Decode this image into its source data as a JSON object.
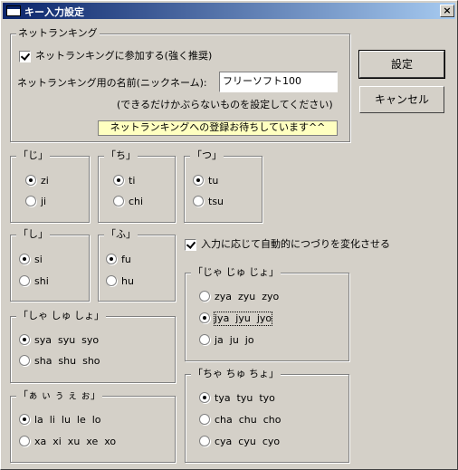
{
  "window": {
    "title": "キー入力設定",
    "close_label": "×"
  },
  "net_ranking": {
    "group_label": "ネットランキング",
    "participate_label": "ネットランキングに参加する(強く推奨)",
    "participate_checked": true,
    "name_label": "ネットランキング用の名前(ニックネーム):",
    "name_value": "フリーソフト100",
    "hint": "(できるだけかぶらないものを設定してください)",
    "status": "ネットランキングへの登録お待ちしています^^"
  },
  "buttons": {
    "ok": "設定",
    "cancel": "キャンセル"
  },
  "groups": {
    "ji": {
      "label": "「じ」",
      "options": [
        "zi",
        "ji"
      ],
      "selected": 0
    },
    "chi": {
      "label": "「ち」",
      "options": [
        "ti",
        "chi"
      ],
      "selected": 0
    },
    "tsu": {
      "label": "「つ」",
      "options": [
        "tu",
        "tsu"
      ],
      "selected": 0
    },
    "shi": {
      "label": "「し」",
      "options": [
        "si",
        "shi"
      ],
      "selected": 0
    },
    "fu": {
      "label": "「ふ」",
      "options": [
        "fu",
        "hu"
      ],
      "selected": 0
    },
    "sha": {
      "label": "「しゃ しゅ しょ」",
      "options": [
        "sya  syu  syo",
        "sha  shu  sho"
      ],
      "selected": 0
    },
    "small_vowel": {
      "label": "「ぁ ぃ ぅ ぇ ぉ」",
      "options": [
        "la  li  lu  le  lo",
        "xa  xi  xu  xe  xo"
      ],
      "selected": 0
    },
    "ja": {
      "label": "「じゃ じゅ じょ」",
      "options": [
        "zya  zyu  zyo",
        "jya  jyu  jyo",
        "ja  ju  jo"
      ],
      "selected": 1
    },
    "cha": {
      "label": "「ちゃ ちゅ ちょ」",
      "options": [
        "tya  tyu  tyo",
        "cha  chu  cho",
        "cya  cyu  cyo"
      ],
      "selected": 0
    }
  },
  "auto_adjust": {
    "label": "入力に応じて自動的につづりを変化させる",
    "checked": true
  }
}
